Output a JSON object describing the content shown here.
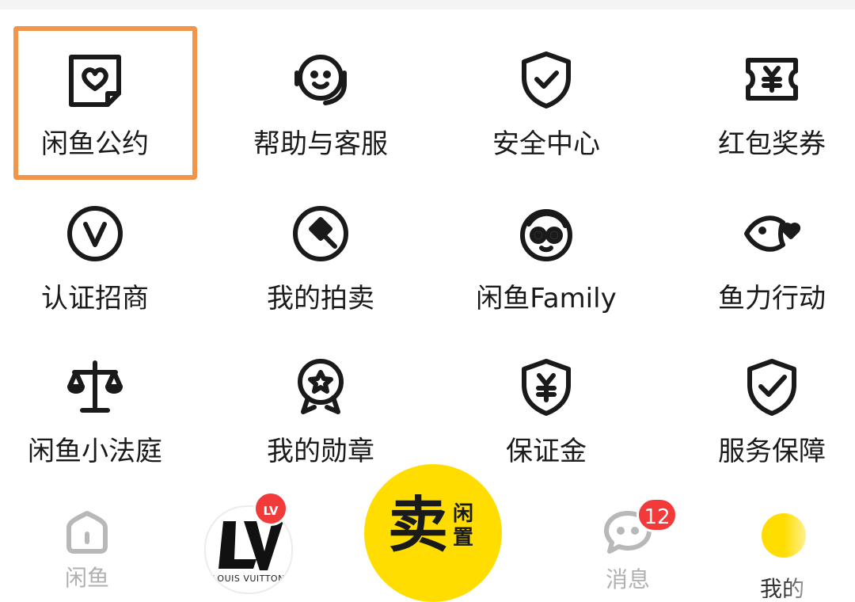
{
  "grid": {
    "items": [
      {
        "label": "闲鱼公约",
        "icon": "heart-badge-icon",
        "highlighted": true
      },
      {
        "label": "帮助与客服",
        "icon": "headset-icon"
      },
      {
        "label": "安全中心",
        "icon": "shield-check-icon"
      },
      {
        "label": "红包奖券",
        "icon": "yen-ticket-icon"
      },
      {
        "label": "认证招商",
        "icon": "verified-v-icon"
      },
      {
        "label": "我的拍卖",
        "icon": "auction-hammer-icon"
      },
      {
        "label": "闲鱼Family",
        "icon": "panda-face-icon"
      },
      {
        "label": "鱼力行动",
        "icon": "fish-heart-icon"
      },
      {
        "label": "闲鱼小法庭",
        "icon": "scale-icon"
      },
      {
        "label": "我的勋章",
        "icon": "medal-star-icon"
      },
      {
        "label": "保证金",
        "icon": "yen-shield-icon"
      },
      {
        "label": "服务保障",
        "icon": "shield-tick-icon"
      }
    ]
  },
  "tabbar": {
    "home": {
      "label": "闲鱼",
      "icon": "home-icon"
    },
    "featured": {
      "badge": "LV",
      "caption": "LOUIS VUITTON",
      "icon": "lv-logo-icon"
    },
    "sell": {
      "big": "卖",
      "small": "闲置"
    },
    "messages": {
      "label": "消息",
      "badge": "12",
      "icon": "chat-bubble-icon"
    },
    "me": {
      "label": "我的"
    }
  },
  "colors": {
    "highlight": "#f0954a",
    "sell_yellow": "#ffdd00",
    "badge_red": "#f33a3a",
    "inactive_tab": "#b0b0b0"
  }
}
